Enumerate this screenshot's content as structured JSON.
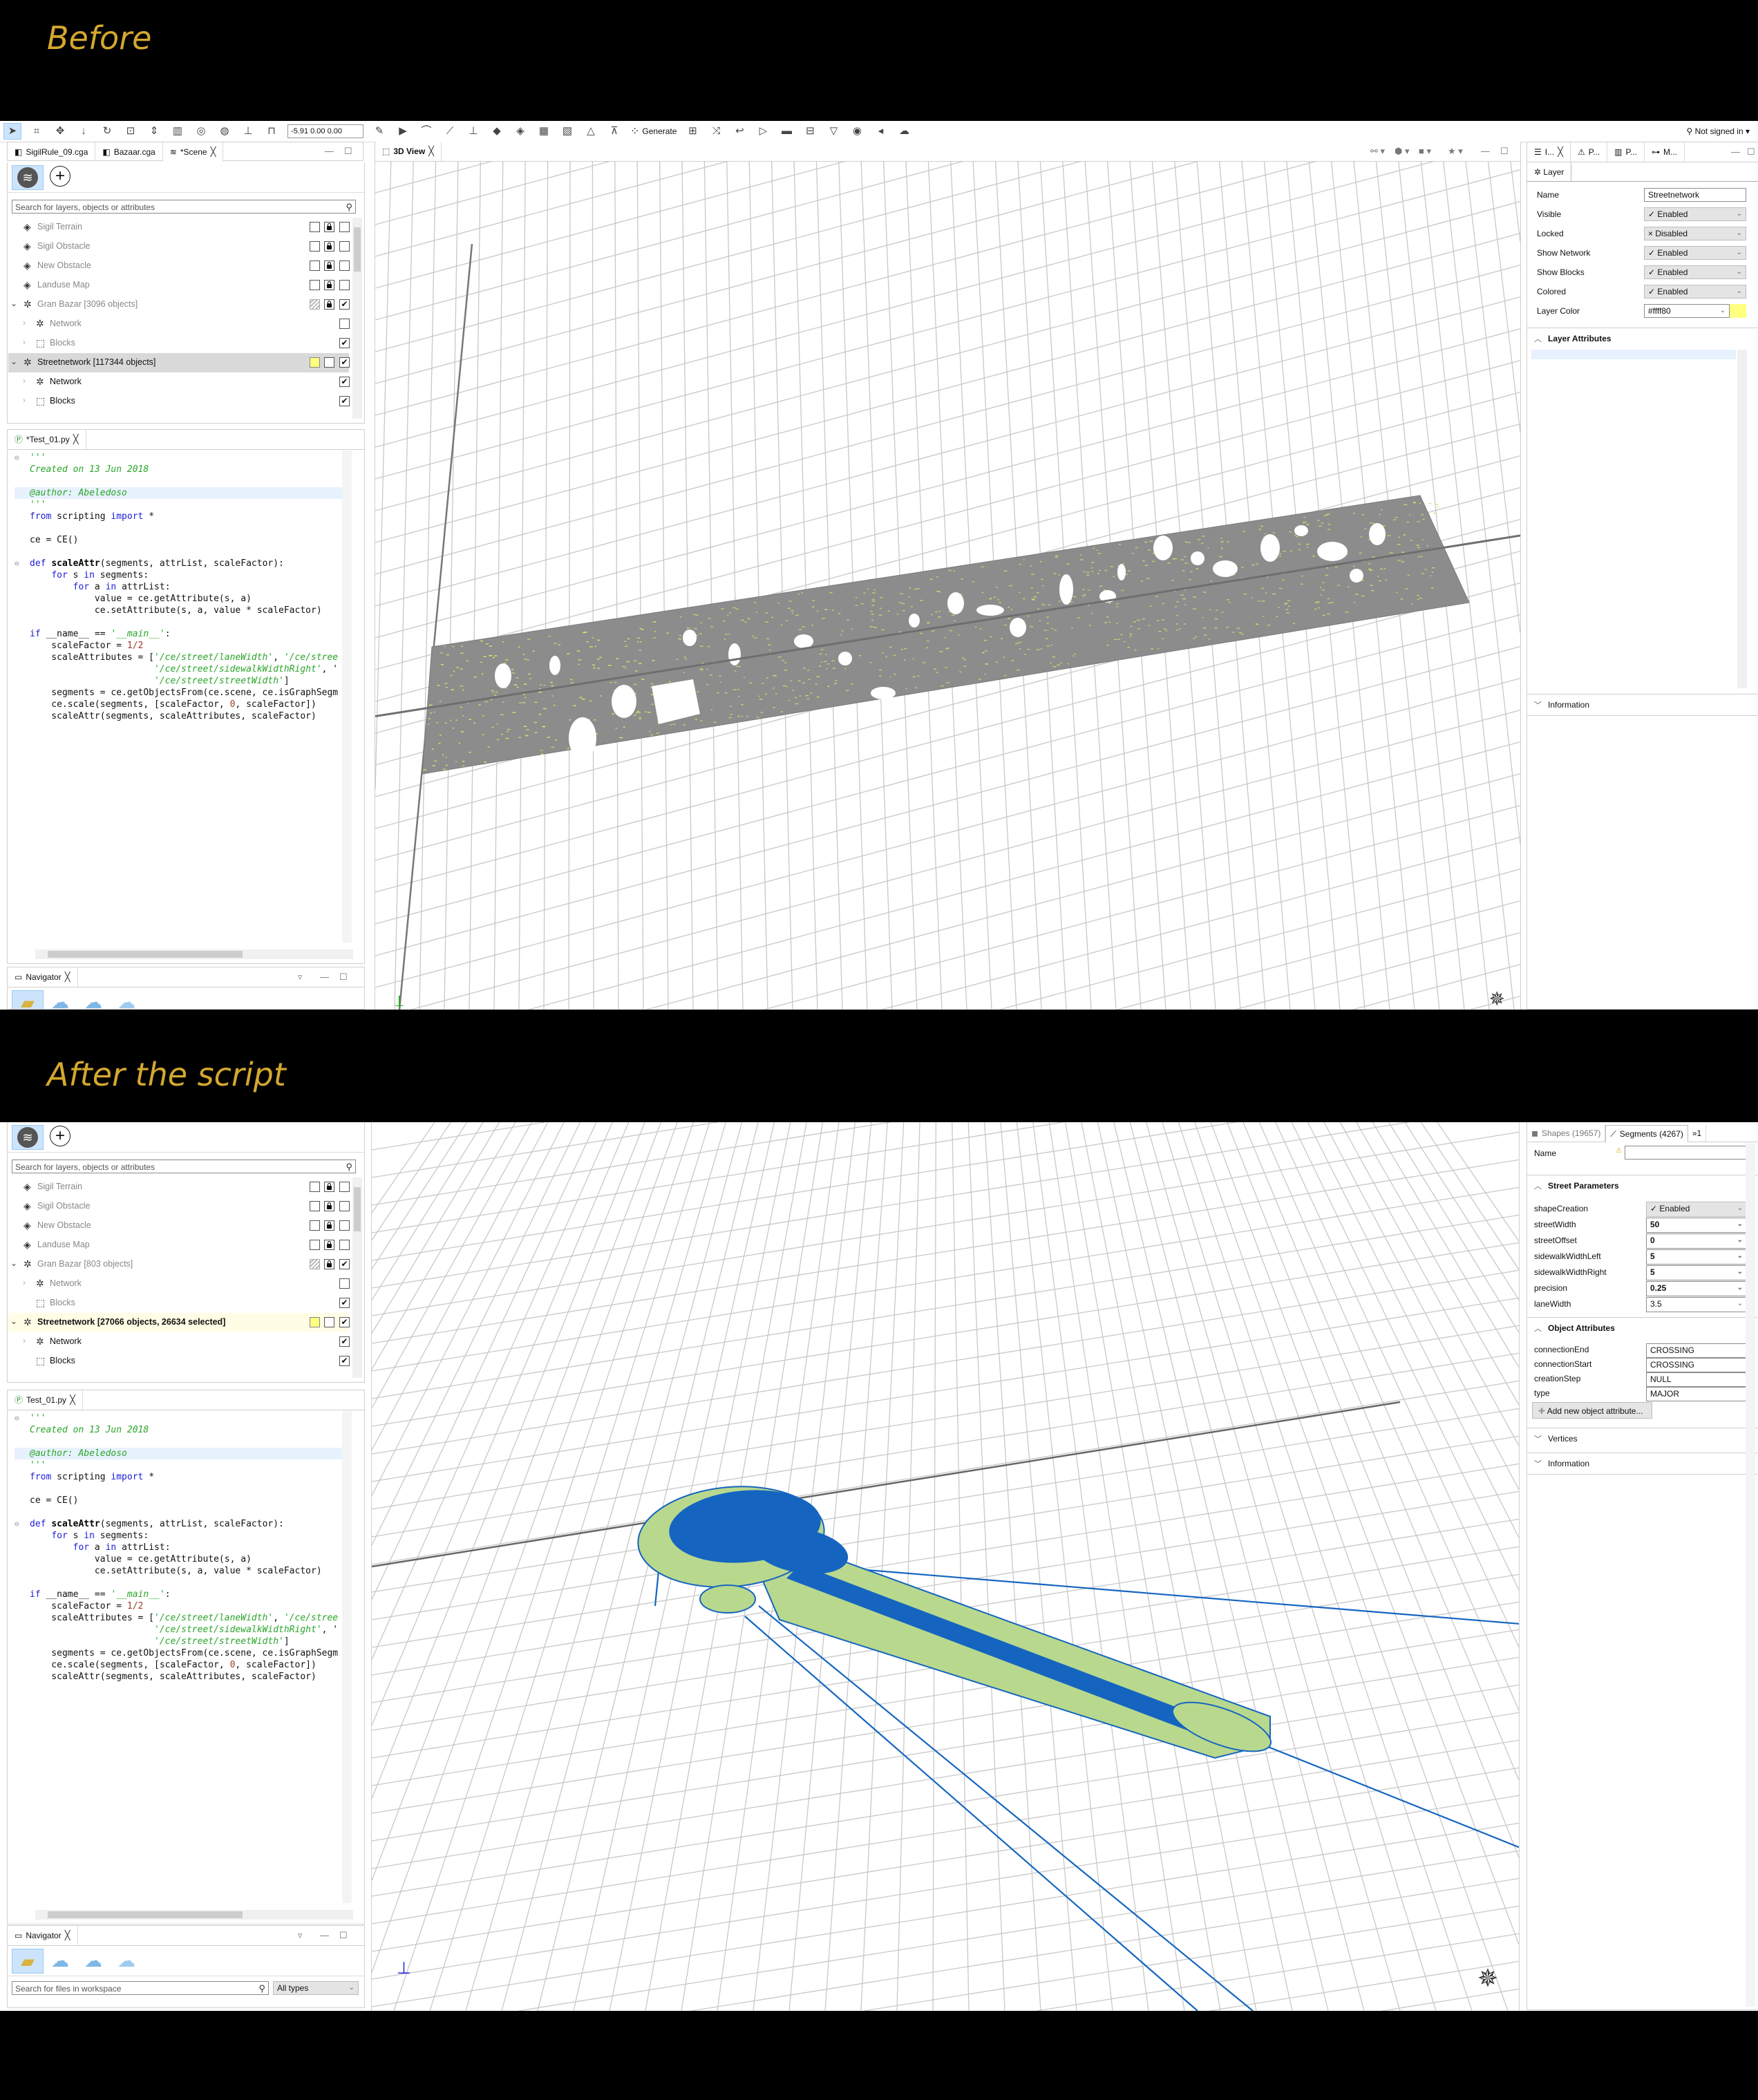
{
  "captions": {
    "before": "Before",
    "after": "After the script"
  },
  "colors": {
    "caption": "#d4a82e",
    "layer_color": "#ffff80",
    "network_gray": "#8c8c8c",
    "network_blue": "#1565c0",
    "shape_green": "#b8d88e",
    "selection_blue": "#cce4fb"
  },
  "toolbar": {
    "icons": [
      "select-arrow-icon",
      "frame-icon",
      "move-icon",
      "move-down-icon",
      "rotate-icon",
      "scale-icon",
      "move-axis-icon",
      "align-icon",
      "rotate-object-icon",
      "globe-icon",
      "align-terrain-icon",
      "lock-icon"
    ],
    "coordinates": "-5.91 0.00 0.00",
    "icons2": [
      "draw-polygon-icon",
      "draw-street-icon",
      "draw-curve-icon",
      "draw-brush-icon",
      "align-terrain-icon",
      "shape-add-icon",
      "shape-subdivide-icon",
      "texture-icon",
      "texture-edit-icon",
      "terrain-icon",
      "terrain-align-icon"
    ],
    "generate": "Generate",
    "icons3": [
      "cga-icon",
      "shuffle-icon",
      "undo-icon",
      "triangle-icon",
      "ruler-icon",
      "measure-icon",
      "funnel-icon",
      "visibility-icon",
      "sound-icon",
      "weather-icon"
    ],
    "user": "Not signed in ▾"
  },
  "code": {
    "lines": [
      [
        [
          "'''",
          "str"
        ]
      ],
      [
        [
          "Created on 13 Jun 2018",
          "str"
        ]
      ],
      [],
      [
        [
          "@author: Abeledoso",
          "str"
        ]
      ],
      [
        [
          "'''",
          "str"
        ]
      ],
      [
        [
          "from",
          "kw"
        ],
        [
          " scripting ",
          "txt"
        ],
        [
          "import",
          "kw"
        ],
        [
          " *",
          "txt"
        ]
      ],
      [],
      [
        [
          "ce = CE()",
          "txt"
        ]
      ],
      [],
      [
        [
          "def",
          "kw"
        ],
        [
          " ",
          "txt"
        ],
        [
          "scaleAttr",
          "fn"
        ],
        [
          "(segments, attrList, scaleFactor):",
          "txt"
        ]
      ],
      [
        [
          "    ",
          "txt"
        ],
        [
          "for",
          "kw"
        ],
        [
          " s ",
          "txt"
        ],
        [
          "in",
          "kw"
        ],
        [
          " segments:",
          "txt"
        ]
      ],
      [
        [
          "        ",
          "txt"
        ],
        [
          "for",
          "kw"
        ],
        [
          " a ",
          "txt"
        ],
        [
          "in",
          "kw"
        ],
        [
          " attrList:",
          "txt"
        ]
      ],
      [
        [
          "            value = ce.getAttribute(s, a)",
          "txt"
        ]
      ],
      [
        [
          "            ce.setAttribute(s, a, value * scaleFactor)",
          "txt"
        ]
      ],
      [],
      [
        [
          "if",
          "kw"
        ],
        [
          " __name__ == ",
          "txt"
        ],
        [
          "'__main__'",
          "str"
        ],
        [
          ":",
          "txt"
        ]
      ],
      [
        [
          "    scaleFactor = ",
          "txt"
        ],
        [
          "1/2",
          "num"
        ]
      ],
      [
        [
          "    scaleAttributes = [",
          "txt"
        ],
        [
          "'/ce/street/laneWidth'",
          "str"
        ],
        [
          ", ",
          "txt"
        ],
        [
          "'/ce/stree",
          "str"
        ]
      ],
      [
        [
          "                       ",
          "txt"
        ],
        [
          "'/ce/street/sidewalkWidthRight'",
          "str"
        ],
        [
          ", '",
          "txt"
        ]
      ],
      [
        [
          "                       ",
          "txt"
        ],
        [
          "'/ce/street/streetWidth'",
          "str"
        ],
        [
          "]",
          "txt"
        ]
      ],
      [
        [
          "    segments = ce.getObjectsFrom(ce.scene, ce.isGraphSegm",
          "txt"
        ]
      ],
      [
        [
          "    ce.scale(segments, [scaleFactor, ",
          "txt"
        ],
        [
          "0",
          "num"
        ],
        [
          ", scaleFactor])",
          "txt"
        ]
      ],
      [
        [
          "    scaleAttr(segments, scaleAttributes, scaleFactor)",
          "txt"
        ]
      ]
    ]
  },
  "before": {
    "left_tabs": [
      {
        "label": "SigilRule_09.cga",
        "icon": "cga-file-icon"
      },
      {
        "label": "Bazaar.cga",
        "icon": "cga-file-icon"
      },
      {
        "label": "*Scene",
        "icon": "scene-icon",
        "close": "╳"
      }
    ],
    "layers": {
      "search_placeholder": "Search for layers, objects or attributes",
      "items": [
        {
          "name": "Sigil Terrain",
          "depth": 0,
          "expander": "none",
          "dim": true,
          "icon": "terrain-layer-icon",
          "boxes": [
            "empty",
            "lock",
            "empty"
          ]
        },
        {
          "name": "Sigil Obstacle",
          "depth": 0,
          "expander": "none",
          "dim": true,
          "icon": "terrain-layer-icon",
          "boxes": [
            "empty",
            "lock",
            "empty"
          ]
        },
        {
          "name": "New Obstacle",
          "depth": 0,
          "expander": "none",
          "dim": true,
          "icon": "terrain-layer-icon",
          "boxes": [
            "empty",
            "lock",
            "empty"
          ]
        },
        {
          "name": "Landuse Map",
          "depth": 0,
          "expander": "none",
          "dim": true,
          "icon": "terrain-layer-icon",
          "boxes": [
            "empty",
            "lock",
            "empty"
          ]
        },
        {
          "name": "Gran Bazar [3096 objects]",
          "depth": 0,
          "expander": "open",
          "dim": true,
          "icon": "network-layer-icon",
          "boxes": [
            "hatch",
            "lock",
            "check"
          ]
        },
        {
          "name": "Network",
          "depth": 1,
          "expander": "closed",
          "dim": true,
          "icon": "network-icon",
          "boxes": [
            null,
            null,
            "empty"
          ]
        },
        {
          "name": "Blocks",
          "depth": 1,
          "expander": "closed",
          "dim": true,
          "icon": "blocks-icon",
          "boxes": [
            null,
            null,
            "check"
          ]
        },
        {
          "name": "Streetnetwork [117344 objects]",
          "depth": 0,
          "expander": "open",
          "dim": false,
          "selected": "gray",
          "icon": "network-layer-icon",
          "boxes": [
            "yellow",
            "empty",
            "check"
          ]
        },
        {
          "name": "Network",
          "depth": 1,
          "expander": "closed",
          "dim": false,
          "icon": "network-icon",
          "boxes": [
            null,
            null,
            "check"
          ]
        },
        {
          "name": "Blocks",
          "depth": 1,
          "expander": "closed",
          "dim": false,
          "icon": "blocks-icon",
          "boxes": [
            null,
            null,
            "check"
          ]
        }
      ]
    },
    "editor_tab": "*Test_01.py",
    "navigator": {
      "title": "Navigator"
    },
    "view_tab": "3D View",
    "right": {
      "tabs": [
        "I...",
        "P...",
        "P...",
        "M..."
      ],
      "layer_tab": "Layer",
      "props": [
        {
          "label": "Name",
          "value": "Streetnetwork",
          "kind": "text"
        },
        {
          "label": "Visible",
          "value": "✓ Enabled",
          "kind": "combo"
        },
        {
          "label": "Locked",
          "value": "× Disabled",
          "kind": "combo"
        },
        {
          "label": "Show Network",
          "value": "✓ Enabled",
          "kind": "combo"
        },
        {
          "label": "Show Blocks",
          "value": "✓ Enabled",
          "kind": "combo"
        },
        {
          "label": "Colored",
          "value": "✓ Enabled",
          "kind": "combo"
        },
        {
          "label": "Layer Color",
          "value": "#ffff80",
          "kind": "color"
        }
      ],
      "layer_attributes": "Layer Attributes",
      "information": "Information"
    }
  },
  "after": {
    "layers": {
      "search_placeholder": "Search for layers, objects or attributes",
      "items": [
        {
          "name": "Sigil Terrain",
          "depth": 0,
          "expander": "none",
          "dim": true,
          "icon": "terrain-layer-icon",
          "boxes": [
            "empty",
            "lock",
            "empty"
          ]
        },
        {
          "name": "Sigil Obstacle",
          "depth": 0,
          "expander": "none",
          "dim": true,
          "icon": "terrain-layer-icon",
          "boxes": [
            "empty",
            "lock",
            "empty"
          ]
        },
        {
          "name": "New Obstacle",
          "depth": 0,
          "expander": "none",
          "dim": true,
          "icon": "terrain-layer-icon",
          "boxes": [
            "empty",
            "lock",
            "empty"
          ]
        },
        {
          "name": "Landuse Map",
          "depth": 0,
          "expander": "none",
          "dim": true,
          "icon": "terrain-layer-icon",
          "boxes": [
            "empty",
            "lock",
            "empty"
          ]
        },
        {
          "name": "Gran Bazar [803 objects]",
          "depth": 0,
          "expander": "open",
          "dim": true,
          "icon": "network-layer-icon",
          "boxes": [
            "hatch",
            "lock",
            "check"
          ]
        },
        {
          "name": "Network",
          "depth": 1,
          "expander": "closed",
          "dim": true,
          "icon": "network-icon",
          "boxes": [
            null,
            null,
            "empty"
          ]
        },
        {
          "name": "Blocks",
          "depth": 1,
          "expander": "none",
          "dim": true,
          "icon": "blocks-icon",
          "boxes": [
            null,
            null,
            "check"
          ]
        },
        {
          "name": "Streetnetwork [27066 objects, 26634 selected]",
          "depth": 0,
          "expander": "open",
          "dim": false,
          "bold": true,
          "selected": "yellow",
          "icon": "network-layer-icon",
          "boxes": [
            "yellow",
            "empty",
            "check"
          ]
        },
        {
          "name": "Network",
          "depth": 1,
          "expander": "closed",
          "dim": false,
          "icon": "network-icon",
          "boxes": [
            null,
            null,
            "check"
          ]
        },
        {
          "name": "Blocks",
          "depth": 1,
          "expander": "none",
          "dim": false,
          "icon": "blocks-icon",
          "boxes": [
            null,
            null,
            "check"
          ]
        }
      ]
    },
    "editor_tab": "Test_01.py",
    "navigator": {
      "title": "Navigator",
      "search_placeholder": "Search for files in workspace",
      "type_filter": "All types"
    },
    "right": {
      "tabs": [
        {
          "label": "Shapes (19657)",
          "icon": "shape-icon"
        },
        {
          "label": "Segments (4267)",
          "icon": "segment-icon"
        },
        {
          "label": "»1",
          "icon": ""
        }
      ],
      "name_label": "Name",
      "name_value": "",
      "street_parameters": "Street Parameters",
      "street_props": [
        {
          "label": "shapeCreation",
          "value": "✓ Enabled",
          "kind": "combo"
        },
        {
          "label": "streetWidth",
          "value": "50",
          "kind": "bold"
        },
        {
          "label": "streetOffset",
          "value": "0",
          "kind": "bold"
        },
        {
          "label": "sidewalkWidthLeft",
          "value": "5",
          "kind": "bold"
        },
        {
          "label": "sidewalkWidthRight",
          "value": "5",
          "kind": "bold"
        },
        {
          "label": "precision",
          "value": "0.25",
          "kind": "bold"
        },
        {
          "label": "laneWidth",
          "value": "3.5",
          "kind": "plain"
        }
      ],
      "object_attributes": "Object Attributes",
      "object_props": [
        {
          "label": "connectionEnd",
          "value": "CROSSING"
        },
        {
          "label": "connectionStart",
          "value": "CROSSING"
        },
        {
          "label": "creationStep",
          "value": "NULL"
        },
        {
          "label": "type",
          "value": "MAJOR"
        }
      ],
      "add_attribute": "Add new object attribute...",
      "vertices": "Vertices",
      "information": "Information"
    }
  }
}
